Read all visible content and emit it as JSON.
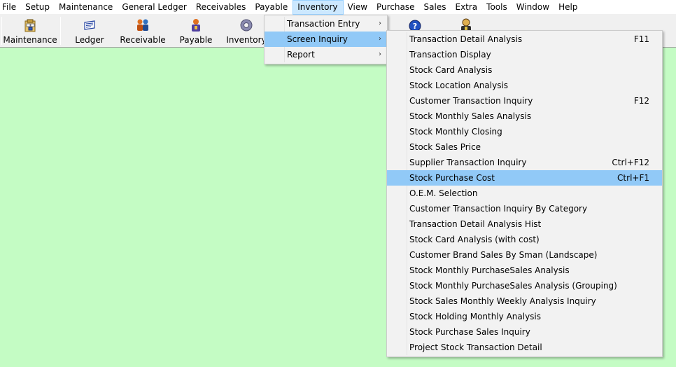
{
  "menubar": [
    "File",
    "Setup",
    "Maintenance",
    "General Ledger",
    "Receivables",
    "Payable",
    "Inventory",
    "View",
    "Purchase",
    "Sales",
    "Extra",
    "Tools",
    "Window",
    "Help"
  ],
  "toolbar": {
    "maintenance": "Maintenance",
    "ledger": "Ledger",
    "receivable": "Receivable",
    "payable": "Payable",
    "inventory": "Inventory"
  },
  "inventory_menu": {
    "transaction_entry": "Transaction Entry",
    "screen_inquiry": "Screen Inquiry",
    "report": "Report",
    "arrow": "›"
  },
  "screen_inquiry_menu": [
    {
      "label": "Transaction Detail Analysis",
      "shortcut": "F11"
    },
    {
      "label": "Transaction Display",
      "shortcut": ""
    },
    {
      "label": "Stock Card Analysis",
      "shortcut": ""
    },
    {
      "label": "Stock Location Analysis",
      "shortcut": ""
    },
    {
      "label": "Customer Transaction Inquiry",
      "shortcut": "F12"
    },
    {
      "label": "Stock Monthly Sales Analysis",
      "shortcut": ""
    },
    {
      "label": "Stock Monthly Closing",
      "shortcut": ""
    },
    {
      "label": "Stock Sales Price",
      "shortcut": ""
    },
    {
      "label": "Supplier Transaction Inquiry",
      "shortcut": "Ctrl+F12"
    },
    {
      "label": "Stock Purchase Cost",
      "shortcut": "Ctrl+F1"
    },
    {
      "label": "O.E.M. Selection",
      "shortcut": ""
    },
    {
      "label": "Customer Transaction Inquiry By Category",
      "shortcut": ""
    },
    {
      "label": "Transaction Detail Analysis Hist",
      "shortcut": ""
    },
    {
      "label": "Stock Card Analysis (with cost)",
      "shortcut": ""
    },
    {
      "label": "Customer Brand Sales By Sman (Landscape)",
      "shortcut": ""
    },
    {
      "label": "Stock Monthly PurchaseSales Analysis",
      "shortcut": ""
    },
    {
      "label": "Stock Monthly PurchaseSales Analysis (Grouping)",
      "shortcut": ""
    },
    {
      "label": "Stock Sales Monthly Weekly Analysis Inquiry",
      "shortcut": ""
    },
    {
      "label": "Stock Holding Monthly Analysis",
      "shortcut": ""
    },
    {
      "label": "Stock Purchase Sales Inquiry",
      "shortcut": ""
    },
    {
      "label": "Project Stock Transaction Detail",
      "shortcut": ""
    }
  ],
  "colors": {
    "background": "#c4fcc4",
    "menu_highlight": "#91c9f7",
    "menubar_active": "#cce8ff"
  }
}
